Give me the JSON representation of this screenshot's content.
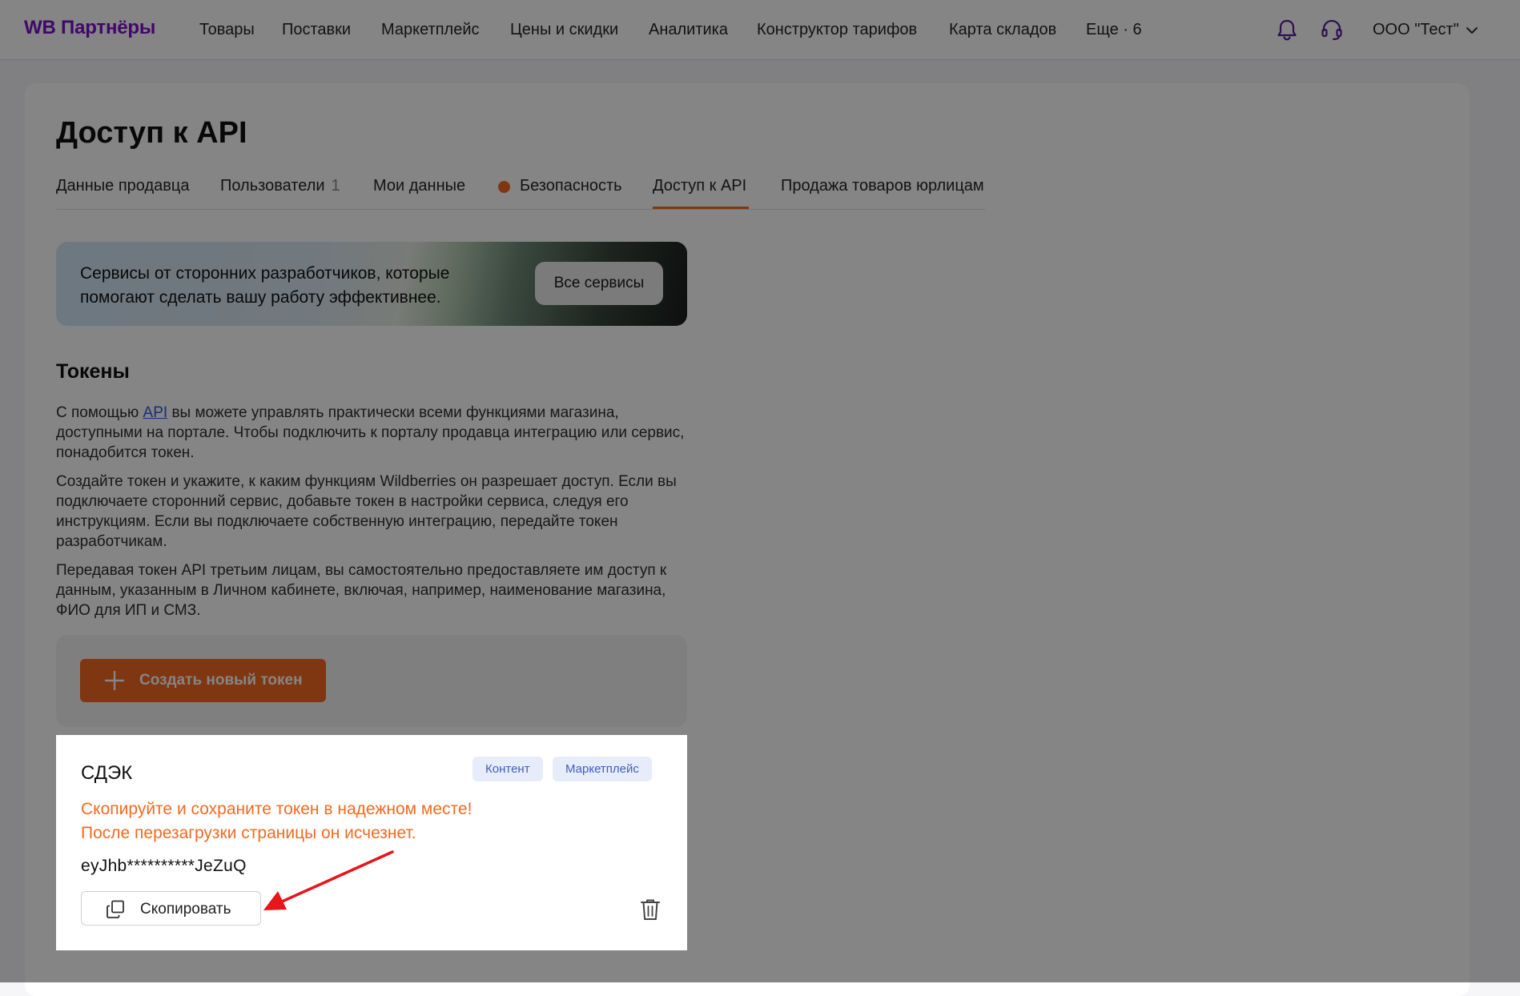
{
  "header": {
    "logo": "WB Партнёры",
    "nav": [
      "Товары",
      "Поставки",
      "Маркетплейс",
      "Цены и скидки",
      "Аналитика",
      "Конструктор тарифов",
      "Карта складов",
      "Еще · 6"
    ],
    "account": "ООО \"Тест\"",
    "icons": [
      "bell-icon",
      "headset-icon",
      "chevron-down-icon"
    ]
  },
  "page": {
    "title": "Доступ к API",
    "tabs": [
      {
        "label": "Данные продавца"
      },
      {
        "label": "Пользователи",
        "count": "1"
      },
      {
        "label": "Мои данные"
      },
      {
        "label": "Безопасность",
        "indicator": "orange-dot"
      },
      {
        "label": "Доступ к API",
        "active": true
      },
      {
        "label": "Продажа товаров юрлицам"
      }
    ]
  },
  "banner": {
    "text_line1": "Сервисы от сторонних разработчиков, которые",
    "text_line2": "помогают сделать вашу работу эффективнее.",
    "button": "Все сервисы"
  },
  "tokens": {
    "title": "Токены",
    "p1_before": "С помощью ",
    "p1_link": "API",
    "p1_after": " вы можете управлять практически всеми функциями магазина, доступными на портале. Чтобы подключить к порталу продавца интеграцию или сервис, понадобится токен.",
    "p2": "Создайте токен и укажите, к каким функциям Wildberries он разрешает доступ. Если вы подключаете сторонний сервис, добавьте токен в настройки сервиса, следуя его инструкциям. Если вы подключаете собственную интеграцию, передайте токен разработчикам.",
    "p3": "Передавая токен API третьим лицам, вы самостоятельно предоставляете им доступ к данным, указанным в Личном кабинете, включая, например, наименование магазина, ФИО для ИП и СМЗ.",
    "create_button": "Создать новый токен"
  },
  "token_card": {
    "name": "СДЭК",
    "badges": [
      "Контент",
      "Маркетплейс"
    ],
    "warning_line1": "Скопируйте и сохраните токен в надежном месте!",
    "warning_line2": "После перезагрузки страницы он исчезнет.",
    "value": "eyJhb**********JeZuQ",
    "copy_button": "Скопировать"
  },
  "colors": {
    "brand": "#7b11c9",
    "accent": "#f26a21",
    "badge_bg": "#e7ecfb",
    "badge_text": "#3f5dbf",
    "annotation_arrow": "#e8151b"
  }
}
